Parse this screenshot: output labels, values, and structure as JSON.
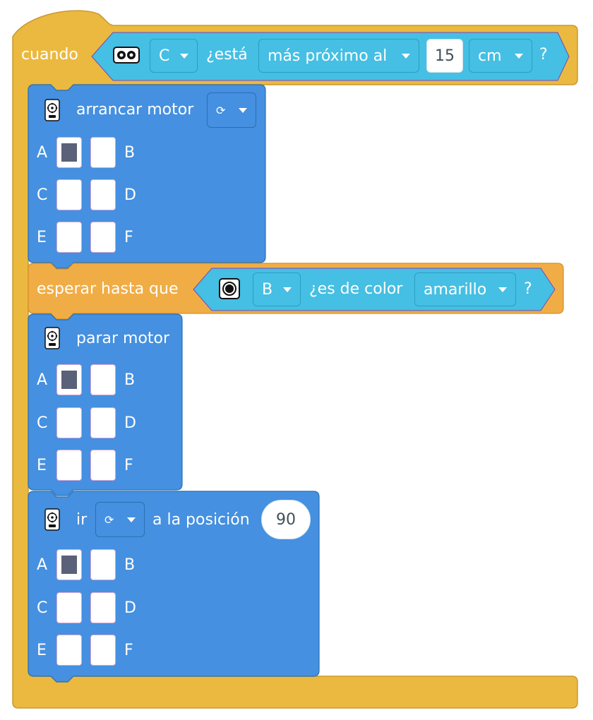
{
  "colors": {
    "event": "#ebb93f",
    "event_dark": "#c9992e",
    "control": "#f1ad45",
    "motor": "#4590e0",
    "motor_dark": "#2a6fb3",
    "sensor": "#45bfe3",
    "port_fill": "#5a6279"
  },
  "when_block": {
    "label": "cuando",
    "sensor_icon": "distance-sensor-icon",
    "port": "C",
    "question": "¿está",
    "comparison": "más próximo al",
    "distance": "15",
    "unit": "cm",
    "question_mark": "?"
  },
  "start_motor": {
    "icon": "motor-icon",
    "label": "arrancar motor",
    "direction_icon": "rotate-icon",
    "ports": {
      "A": {
        "label": "A",
        "selected": true
      },
      "B": {
        "label": "B",
        "selected": false
      },
      "C": {
        "label": "C",
        "selected": false
      },
      "D": {
        "label": "D",
        "selected": false
      },
      "E": {
        "label": "E",
        "selected": false
      },
      "F": {
        "label": "F",
        "selected": false
      }
    }
  },
  "wait_until": {
    "label": "esperar hasta que",
    "sensor_icon": "color-sensor-icon",
    "port": "B",
    "question": "¿es de color",
    "color": "amarillo",
    "question_mark": "?"
  },
  "stop_motor": {
    "icon": "motor-icon",
    "label": "parar motor",
    "ports": {
      "A": {
        "label": "A",
        "selected": true
      },
      "B": {
        "label": "B",
        "selected": false
      },
      "C": {
        "label": "C",
        "selected": false
      },
      "D": {
        "label": "D",
        "selected": false
      },
      "E": {
        "label": "E",
        "selected": false
      },
      "F": {
        "label": "F",
        "selected": false
      }
    }
  },
  "go_to_position": {
    "icon": "motor-icon",
    "label_before": "ir",
    "direction_icon": "rotate-icon",
    "label_after": "a la posición",
    "position": "90",
    "ports": {
      "A": {
        "label": "A",
        "selected": true
      },
      "B": {
        "label": "B",
        "selected": false
      },
      "C": {
        "label": "C",
        "selected": false
      },
      "D": {
        "label": "D",
        "selected": false
      },
      "E": {
        "label": "E",
        "selected": false
      },
      "F": {
        "label": "F",
        "selected": false
      }
    }
  }
}
